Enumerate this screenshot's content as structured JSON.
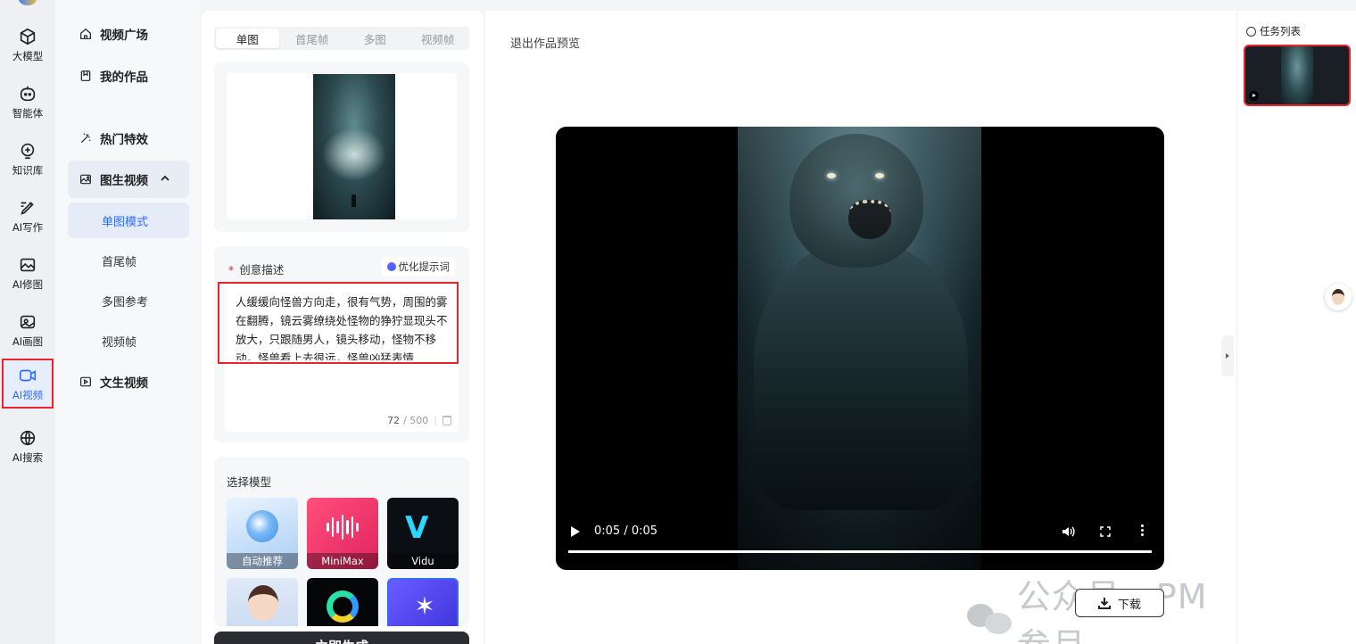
{
  "rail": {
    "items": [
      {
        "label": "大模型",
        "icon": "cube-icon"
      },
      {
        "label": "智能体",
        "icon": "agent-icon"
      },
      {
        "label": "知识库",
        "icon": "knowledge-icon"
      },
      {
        "label": "AI写作",
        "icon": "pen-icon"
      },
      {
        "label": "AI修图",
        "icon": "image-edit-icon"
      },
      {
        "label": "AI画图",
        "icon": "image-gen-icon"
      },
      {
        "label": "AI视频",
        "icon": "video-icon",
        "active": true
      },
      {
        "label": "AI搜索",
        "icon": "globe-icon"
      }
    ]
  },
  "subnav": {
    "video_square": "视频广场",
    "my_works": "我的作品",
    "hot_effects": "热门特效",
    "image_to_video": "图生视频",
    "sub_items": [
      "单图模式",
      "首尾帧",
      "多图参考",
      "视频帧"
    ],
    "text_to_video": "文生视频"
  },
  "form": {
    "tabs": [
      "单图",
      "首尾帧",
      "多图",
      "视频帧"
    ],
    "active_tab": "单图",
    "description_label": "创意描述",
    "optimize_button": "优化提示词",
    "description_text": "人缓缓向怪兽方向走，很有气势，周围的雾在翻腾，镜云雾缭绕处怪物的狰狞显现头不放大，只跟随男人，镜头移动，怪物不移动，怪兽看上去很远，怪兽凶猛表情",
    "char_count": "72",
    "char_max": "/ 500",
    "model_section_label": "选择模型",
    "models": [
      {
        "label": "自动推荐"
      },
      {
        "label": "MiniMax"
      },
      {
        "label": "Vidu"
      }
    ],
    "generate_button": "立即生成"
  },
  "preview": {
    "exit_label": "退出作品预览",
    "time_display": "0:05 / 0:05",
    "progress": 1.0,
    "download_label": "下载",
    "watermark": "公众号 · PM叁月"
  },
  "tasks": {
    "title": "任务列表"
  },
  "colors": {
    "accent": "#2f6bff",
    "highlight_red": "#e8242c",
    "generate_button": "#2b2d33"
  }
}
